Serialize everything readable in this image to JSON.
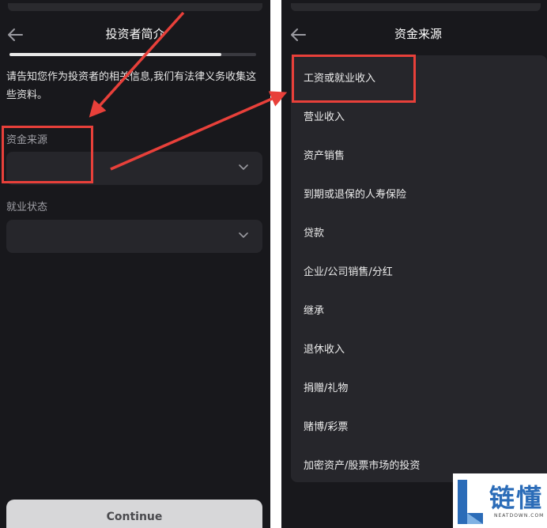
{
  "left_screen": {
    "title": "投资者简介",
    "progress": 0.86,
    "intro_text": "请告知您作为投资者的相关信息,我们有法律义务收集这些资料。",
    "fields": [
      {
        "label": "资金来源",
        "value": ""
      },
      {
        "label": "就业状态",
        "value": ""
      }
    ],
    "continue_label": "Continue"
  },
  "right_screen": {
    "title": "资金来源",
    "options": [
      "工资或就业收入",
      "营业收入",
      "资产销售",
      "到期或退保的人寿保险",
      "贷款",
      "企业/公司销售/分红",
      "继承",
      "退休收入",
      "捐赠/礼物",
      "赌博/彩票",
      "加密资产/股票市场的投资"
    ]
  },
  "watermark": {
    "text": "链懂",
    "subtext": "NEATDOWN.COM"
  },
  "colors": {
    "background": "#18181c",
    "field": "#26262b",
    "highlight": "#e8403a",
    "watermark_blue": "#2b6cb8"
  },
  "icons": [
    "back-arrow-icon",
    "chevron-down-icon"
  ]
}
